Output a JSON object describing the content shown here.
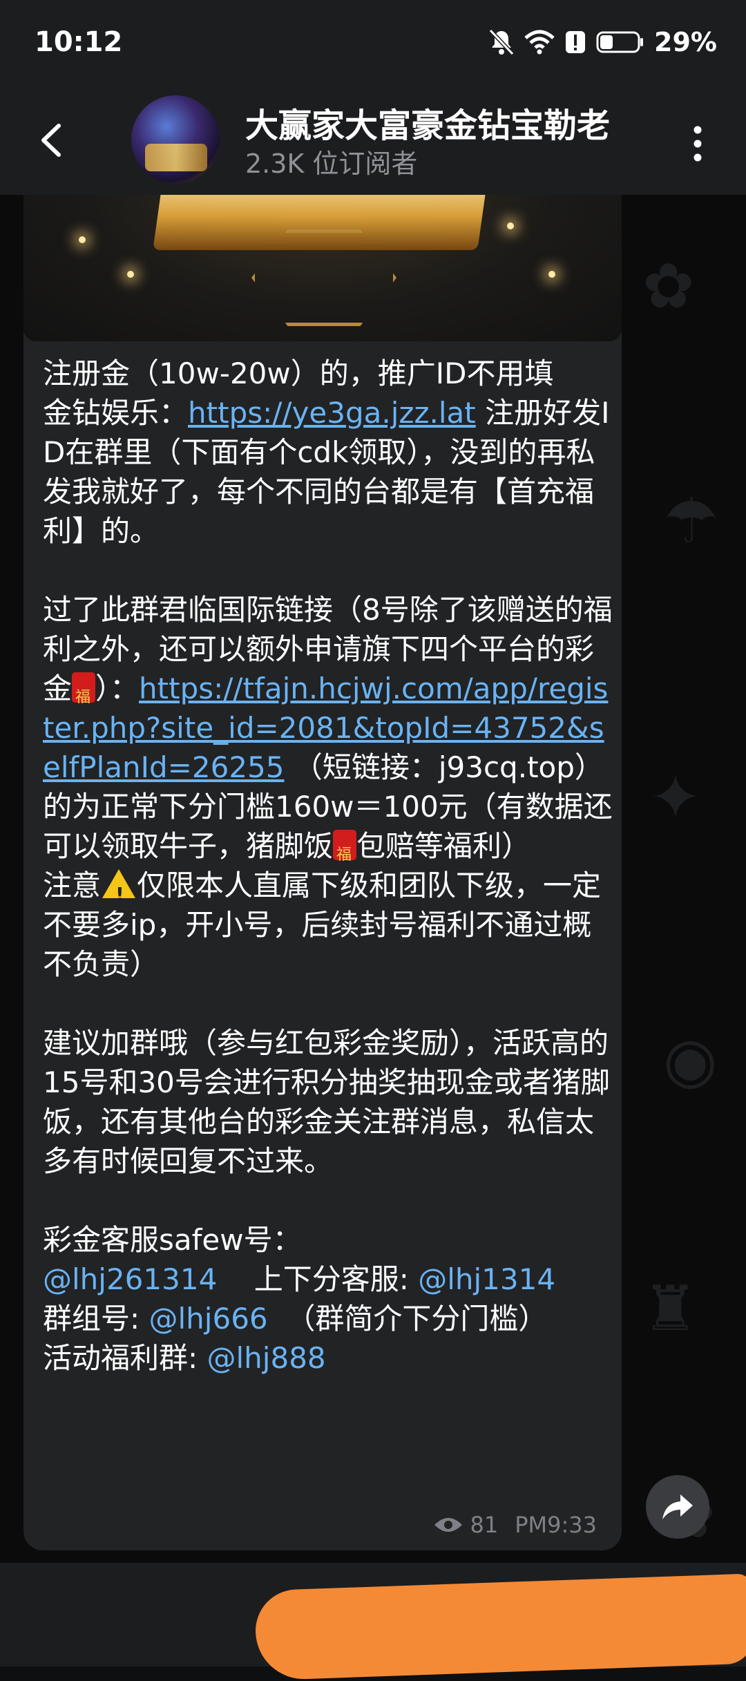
{
  "status_bar": {
    "time": "10:12",
    "battery_percent": "29%",
    "icons": [
      "bell-off-icon",
      "wifi-icon",
      "alert-icon",
      "battery-icon"
    ]
  },
  "header": {
    "channel_title": "大赢家大富豪金钻宝勒老",
    "subscribers": "2.3K 位订阅者"
  },
  "message": {
    "p1": "注册金（10w-20w）的，推广ID不用填",
    "p2_prefix": "金钻娱乐：",
    "p2_link": "https://ye3ga.jzz.lat",
    "p2_suffix": " 注册好发ID在群里（下面有个cdk领取），没到的再私发我就好了，每个不同的台都是有【首充福利】的。",
    "p3_prefix": "过了此群君临国际链接（8号除了该赠送的福利之外，还可以额外申请旗下四个平台的彩金",
    "p3_mid": "）：",
    "p3_link": "https://tfajn.hcjwj.com/app/register.php?site_id=2081&topId=43752&selfPlanId=26255",
    "p3_suffix_a": " （短链接：j93cq.top）的为正常下分门槛160w＝100元（有数据还可以领取牛子，猪脚饭",
    "p3_suffix_b": "包赔等福利）",
    "p4_prefix": "注意",
    "p4_suffix": "仅限本人直属下级和团队下级，一定不要多ip，开小号，后续封号福利不通过概不负责）",
    "p5": "建议加群哦（参与红包彩金奖励），活跃高的15号和30号会进行积分抽奖抽现金或者猪脚饭，还有其他台的彩金关注群消息，私信太多有时候回复不过来。",
    "p6_label": "彩金客服safew号：",
    "p6_mention1": "@lhj261314",
    "p6_mid": "    上下分客服: ",
    "p6_mention2": "@lhj1314",
    "p7_label": "群组号: ",
    "p7_mention": "@lhj666",
    "p7_suffix": "  （群简介下分门槛）",
    "p8_label": "活动福利群: ",
    "p8_mention": "@lhj888",
    "views": "81",
    "time": "PM9:33"
  }
}
